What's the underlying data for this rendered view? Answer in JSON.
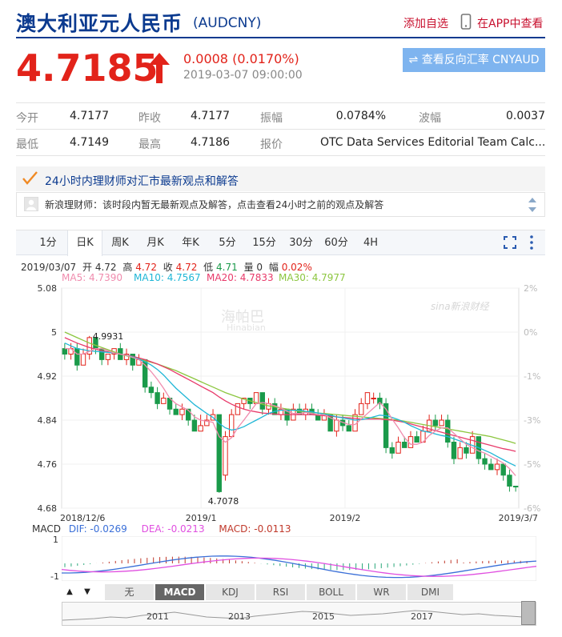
{
  "header": {
    "title": "澳大利亚元人民币",
    "code": "(AUDCNY)",
    "add_watch": "添加自选",
    "app_view": "在APP中查看"
  },
  "quote": {
    "price": "4.7185",
    "change": "0.0008 (0.0170%)",
    "time": "2019-03-07 09:00:00",
    "reverse_button": "查看反向汇率 CNYAUD",
    "up_color": "#e2231a"
  },
  "stats": {
    "open_label": "今开",
    "open": "4.7177",
    "prev_close_label": "昨收",
    "prev_close": "4.7177",
    "amplitude_label": "振幅",
    "amplitude": "0.0784%",
    "range_label": "波幅",
    "range": "0.0037",
    "low_label": "最低",
    "low": "4.7149",
    "high_label": "最高",
    "high": "4.7186",
    "quote_label": "报价",
    "quote_source": "OTC Data Services Editorial Team Calc..."
  },
  "advisor": {
    "title": "24小时内理财师对汇市最新观点和解答",
    "message": "新浪理财师：该时段内暂无最新观点及解答，点击查看24小时之前的观点及解答"
  },
  "chart_tabs": [
    "1分",
    "日K",
    "周K",
    "月K",
    "年K",
    "5分",
    "15分",
    "30分",
    "60分",
    "4H"
  ],
  "active_tab": "日K",
  "kline_info": {
    "date": "2019/03/07",
    "open_label": "开",
    "open": "4.72",
    "high_label": "高",
    "high": "4.72",
    "close_label": "收",
    "close": "4.72",
    "low_label": "低",
    "low": "4.71",
    "vol_label": "量",
    "vol": "0",
    "amp_label": "幅",
    "amp": "0.02%"
  },
  "ma": {
    "ma5": "MA5: 4.7390",
    "ma10": "MA10: 4.7567",
    "ma20": "MA20: 4.7833",
    "ma30": "MA30: 4.7977",
    "colors": {
      "ma5": "#f08cae",
      "ma10": "#1fb6d6",
      "ma20": "#e83a6a",
      "ma30": "#8cc63f"
    }
  },
  "watermark": {
    "brand": "sina新浪财经",
    "hb": "海帕巴",
    "hb_en": "Hinabian"
  },
  "chart_data": {
    "type": "candlestick",
    "y_ticks": [
      "5.08",
      "5",
      "4.92",
      "4.84",
      "4.76",
      "4.68"
    ],
    "ylim": [
      4.68,
      5.08
    ],
    "pct_ticks": [
      "2%",
      "0%",
      "-1%",
      "-3%",
      "-5%",
      "-6%"
    ],
    "x_labels": [
      "2018/12/6",
      "2019/1",
      "2019/2",
      "2019/3/7"
    ],
    "annotations": [
      {
        "label": "4.9931"
      },
      {
        "label": "4.7078"
      }
    ],
    "candles": [
      [
        4.97,
        4.96,
        4.98,
        4.95
      ],
      [
        4.96,
        4.97,
        4.98,
        4.95
      ],
      [
        4.97,
        4.94,
        4.98,
        4.93
      ],
      [
        4.94,
        4.96,
        4.97,
        4.94
      ],
      [
        4.96,
        4.99,
        4.993,
        4.95
      ],
      [
        4.99,
        4.97,
        4.99,
        4.96
      ],
      [
        4.97,
        4.95,
        4.97,
        4.94
      ],
      [
        4.95,
        4.96,
        4.96,
        4.94
      ],
      [
        4.96,
        4.97,
        4.97,
        4.95
      ],
      [
        4.97,
        4.95,
        4.98,
        4.95
      ],
      [
        4.95,
        4.96,
        4.97,
        4.94
      ],
      [
        4.96,
        4.94,
        4.96,
        4.93
      ],
      [
        4.94,
        4.95,
        4.96,
        4.94
      ],
      [
        4.95,
        4.9,
        4.95,
        4.89
      ],
      [
        4.9,
        4.89,
        4.91,
        4.88
      ],
      [
        4.89,
        4.87,
        4.9,
        4.86
      ],
      [
        4.87,
        4.88,
        4.89,
        4.87
      ],
      [
        4.88,
        4.86,
        4.88,
        4.85
      ],
      [
        4.86,
        4.85,
        4.87,
        4.85
      ],
      [
        4.85,
        4.86,
        4.87,
        4.84
      ],
      [
        4.86,
        4.84,
        4.86,
        4.83
      ],
      [
        4.84,
        4.82,
        4.85,
        4.82
      ],
      [
        4.82,
        4.83,
        4.85,
        4.82
      ],
      [
        4.83,
        4.84,
        4.85,
        4.83
      ],
      [
        4.84,
        4.85,
        4.86,
        4.84
      ],
      [
        4.85,
        4.71,
        4.85,
        4.708
      ],
      [
        4.74,
        4.81,
        4.82,
        4.73
      ],
      [
        4.81,
        4.85,
        4.86,
        4.81
      ],
      [
        4.85,
        4.87,
        4.87,
        4.85
      ],
      [
        4.87,
        4.88,
        4.88,
        4.86
      ],
      [
        4.88,
        4.87,
        4.88,
        4.86
      ],
      [
        4.87,
        4.89,
        4.89,
        4.87
      ],
      [
        4.89,
        4.86,
        4.89,
        4.85
      ],
      [
        4.86,
        4.87,
        4.88,
        4.85
      ],
      [
        4.87,
        4.85,
        4.88,
        4.85
      ],
      [
        4.85,
        4.86,
        4.87,
        4.84
      ],
      [
        4.86,
        4.84,
        4.86,
        4.83
      ],
      [
        4.84,
        4.86,
        4.87,
        4.84
      ],
      [
        4.86,
        4.85,
        4.87,
        4.85
      ],
      [
        4.85,
        4.86,
        4.87,
        4.84
      ],
      [
        4.86,
        4.85,
        4.87,
        4.85
      ],
      [
        4.85,
        4.84,
        4.86,
        4.84
      ],
      [
        4.84,
        4.85,
        4.86,
        4.84
      ],
      [
        4.85,
        4.82,
        4.85,
        4.82
      ],
      [
        4.82,
        4.84,
        4.85,
        4.81
      ],
      [
        4.84,
        4.83,
        4.85,
        4.82
      ],
      [
        4.83,
        4.82,
        4.84,
        4.82
      ],
      [
        4.82,
        4.85,
        4.86,
        4.82
      ],
      [
        4.85,
        4.87,
        4.88,
        4.85
      ],
      [
        4.87,
        4.89,
        4.89,
        4.86
      ],
      [
        4.88,
        4.88,
        4.89,
        4.87
      ],
      [
        4.88,
        4.87,
        4.89,
        4.86
      ],
      [
        4.87,
        4.79,
        4.88,
        4.78
      ],
      [
        4.79,
        4.78,
        4.8,
        4.77
      ],
      [
        4.78,
        4.8,
        4.81,
        4.78
      ],
      [
        4.8,
        4.79,
        4.81,
        4.79
      ],
      [
        4.79,
        4.81,
        4.82,
        4.79
      ],
      [
        4.81,
        4.8,
        4.82,
        4.8
      ],
      [
        4.8,
        4.82,
        4.83,
        4.8
      ],
      [
        4.82,
        4.84,
        4.85,
        4.82
      ],
      [
        4.84,
        4.83,
        4.85,
        4.82
      ],
      [
        4.83,
        4.84,
        4.85,
        4.83
      ],
      [
        4.84,
        4.8,
        4.85,
        4.79
      ],
      [
        4.8,
        4.77,
        4.81,
        4.76
      ],
      [
        4.77,
        4.79,
        4.8,
        4.77
      ],
      [
        4.79,
        4.78,
        4.8,
        4.77
      ],
      [
        4.78,
        4.81,
        4.82,
        4.78
      ],
      [
        4.81,
        4.77,
        4.81,
        4.76
      ],
      [
        4.77,
        4.76,
        4.78,
        4.75
      ],
      [
        4.76,
        4.75,
        4.77,
        4.75
      ],
      [
        4.75,
        4.76,
        4.77,
        4.74
      ],
      [
        4.76,
        4.74,
        4.76,
        4.73
      ],
      [
        4.74,
        4.72,
        4.75,
        4.71
      ],
      [
        4.72,
        4.7185,
        4.72,
        4.71
      ]
    ],
    "ma5": [
      4.97,
      4.97,
      4.96,
      4.96,
      4.965,
      4.97,
      4.97,
      4.966,
      4.962,
      4.96,
      4.958,
      4.954,
      4.95,
      4.94,
      4.928,
      4.914,
      4.898,
      4.88,
      4.87,
      4.864,
      4.858,
      4.846,
      4.84,
      4.838,
      4.836,
      4.81,
      4.8,
      4.808,
      4.826,
      4.84,
      4.855,
      4.87,
      4.872,
      4.87,
      4.866,
      4.862,
      4.856,
      4.852,
      4.852,
      4.854,
      4.852,
      4.85,
      4.85,
      4.844,
      4.84,
      4.836,
      4.832,
      4.832,
      4.842,
      4.852,
      4.862,
      4.872,
      4.86,
      4.842,
      4.826,
      4.808,
      4.796,
      4.796,
      4.8,
      4.812,
      4.82,
      4.826,
      4.826,
      4.816,
      4.806,
      4.796,
      4.79,
      4.784,
      4.78,
      4.774,
      4.768,
      4.762,
      4.752,
      4.739
    ],
    "ma10": [
      4.98,
      4.975,
      4.97,
      4.968,
      4.966,
      4.965,
      4.964,
      4.963,
      4.962,
      4.96,
      4.958,
      4.955,
      4.951,
      4.946,
      4.94,
      4.932,
      4.922,
      4.91,
      4.898,
      4.888,
      4.878,
      4.868,
      4.86,
      4.852,
      4.845,
      4.834,
      4.826,
      4.822,
      4.824,
      4.828,
      4.834,
      4.84,
      4.846,
      4.852,
      4.856,
      4.858,
      4.858,
      4.858,
      4.858,
      4.856,
      4.855,
      4.853,
      4.851,
      4.849,
      4.846,
      4.844,
      4.842,
      4.84,
      4.841,
      4.843,
      4.846,
      4.849,
      4.848,
      4.845,
      4.841,
      4.836,
      4.83,
      4.825,
      4.82,
      4.818,
      4.815,
      4.812,
      4.81,
      4.806,
      4.802,
      4.798,
      4.794,
      4.79,
      4.785,
      4.78,
      4.774,
      4.768,
      4.762,
      4.7567
    ],
    "ma20": [
      4.99,
      4.985,
      4.98,
      4.976,
      4.972,
      4.969,
      4.966,
      4.964,
      4.962,
      4.96,
      4.958,
      4.956,
      4.953,
      4.95,
      4.946,
      4.942,
      4.937,
      4.932,
      4.926,
      4.92,
      4.914,
      4.908,
      4.902,
      4.896,
      4.89,
      4.882,
      4.875,
      4.869,
      4.864,
      4.86,
      4.857,
      4.855,
      4.853,
      4.852,
      4.851,
      4.85,
      4.85,
      4.85,
      4.85,
      4.85,
      4.85,
      4.849,
      4.848,
      4.847,
      4.846,
      4.845,
      4.844,
      4.843,
      4.842,
      4.842,
      4.842,
      4.842,
      4.841,
      4.84,
      4.838,
      4.836,
      4.833,
      4.83,
      4.827,
      4.824,
      4.821,
      4.818,
      4.815,
      4.812,
      4.809,
      4.806,
      4.803,
      4.8,
      4.797,
      4.794,
      4.791,
      4.788,
      4.786,
      4.7833
    ],
    "ma30": [
      5.0,
      4.995,
      4.99,
      4.985,
      4.98,
      4.976,
      4.972,
      4.968,
      4.964,
      4.96,
      4.957,
      4.954,
      4.951,
      4.948,
      4.945,
      4.942,
      4.938,
      4.934,
      4.93,
      4.925,
      4.92,
      4.915,
      4.91,
      4.905,
      4.9,
      4.895,
      4.89,
      4.886,
      4.882,
      4.878,
      4.875,
      4.872,
      4.869,
      4.866,
      4.864,
      4.862,
      4.86,
      4.858,
      4.856,
      4.855,
      4.854,
      4.853,
      4.852,
      4.851,
      4.85,
      4.849,
      4.848,
      4.847,
      4.846,
      4.845,
      4.844,
      4.843,
      4.842,
      4.841,
      4.84,
      4.838,
      4.836,
      4.834,
      4.832,
      4.83,
      4.828,
      4.826,
      4.824,
      4.822,
      4.82,
      4.818,
      4.816,
      4.814,
      4.812,
      4.81,
      4.807,
      4.804,
      4.801,
      4.7977
    ]
  },
  "macd": {
    "label": "MACD",
    "dif": "DIF: -0.0269",
    "dea": "DEA: -0.0213",
    "macd": "MACD: -0.0113",
    "axis_top": "1",
    "axis_bottom": "-1",
    "colors": {
      "dif": "#3a6fd8",
      "dea": "#e04fe0",
      "macd": "#c0392b",
      "hist_up": "#c0392b",
      "hist_down": "#2aa77a"
    }
  },
  "indicator_tabs": [
    "无",
    "MACD",
    "KDJ",
    "RSI",
    "BOLL",
    "WR",
    "DMI"
  ],
  "active_indicator": "MACD",
  "nav": {
    "up": "▲",
    "down": "▼"
  },
  "timeline_years": [
    "2011",
    "2013",
    "2015",
    "2017"
  ]
}
